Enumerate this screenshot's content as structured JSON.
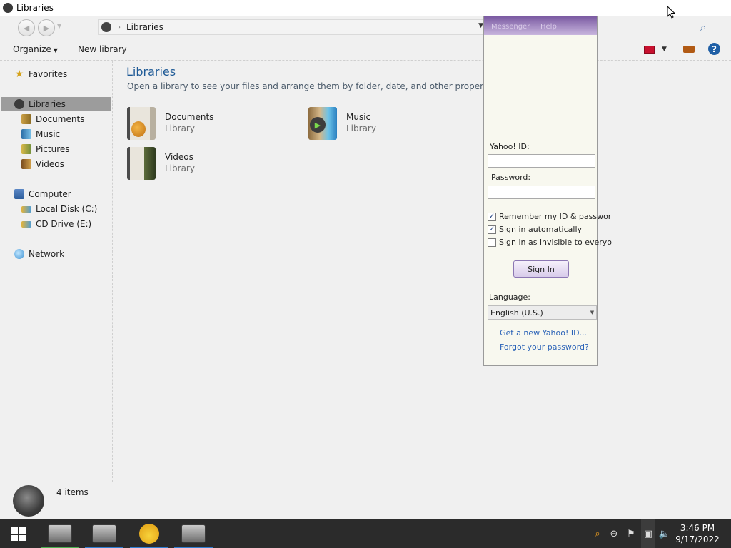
{
  "window": {
    "title": "Libraries"
  },
  "address": {
    "crumb": "Libraries"
  },
  "toolbar": {
    "organize_label": "Organize",
    "new_library_label": "New library"
  },
  "sidebar": {
    "favorites": "Favorites",
    "libraries": "Libraries",
    "library_items": [
      "Documents",
      "Music",
      "Pictures",
      "Videos"
    ],
    "computer": "Computer",
    "drives": [
      "Local Disk (C:)",
      "CD Drive (E:)"
    ],
    "network": "Network"
  },
  "main": {
    "title": "Libraries",
    "subtitle": "Open a library to see your files and arrange them by folder, date, and other properties.",
    "libraries": [
      {
        "name": "Documents",
        "kind": "Library",
        "icon": "documents-library-icon"
      },
      {
        "name": "Music",
        "kind": "Library",
        "icon": "music-library-icon"
      },
      {
        "name": "Videos",
        "kind": "Library",
        "icon": "videos-library-icon"
      }
    ]
  },
  "status": {
    "count": "4 items"
  },
  "yahoo": {
    "menu": [
      "Messenger",
      "Help"
    ],
    "id_label": "Yahoo! ID:",
    "id_value": "",
    "password_label": "Password:",
    "password_value": "",
    "checks": [
      {
        "label": "Remember my ID & passwor",
        "checked": true
      },
      {
        "label": "Sign in automatically",
        "checked": true
      },
      {
        "label": "Sign in as invisible to everyo",
        "checked": false
      }
    ],
    "signin_label": "Sign In",
    "language_label": "Language:",
    "language_value": "English (U.S.)",
    "links": [
      "Get a new Yahoo! ID...",
      "Forgot your password?"
    ]
  },
  "taskbar": {
    "apps": [
      {
        "name": "video-app-1",
        "indicator": "#4caf50"
      },
      {
        "name": "video-app-2",
        "indicator": "#2f7dd1"
      },
      {
        "name": "yahoo-messenger",
        "indicator": "#2f7dd1"
      },
      {
        "name": "video-app-3",
        "indicator": "#2f7dd1"
      }
    ],
    "time": "3:46 PM",
    "date": "9/17/2022"
  }
}
